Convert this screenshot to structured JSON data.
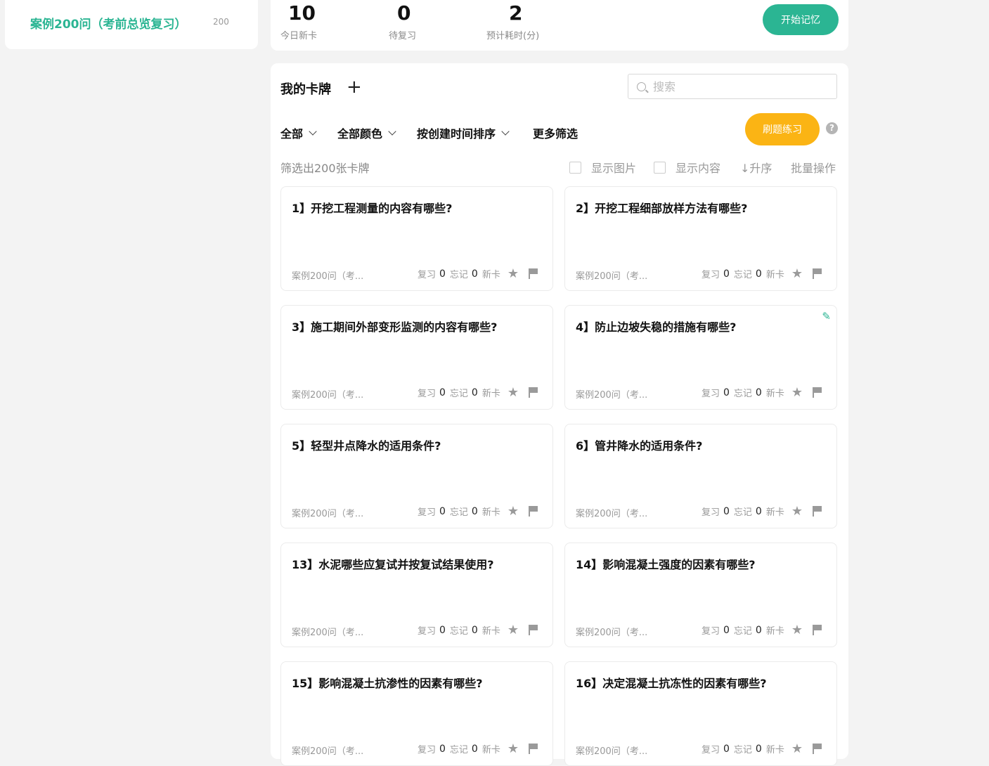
{
  "sidebar": {
    "deck_name": "案例200问（考前总览复习）",
    "deck_count": "200"
  },
  "stats": [
    {
      "value": "10",
      "label": "今日新卡"
    },
    {
      "value": "0",
      "label": "待复习"
    },
    {
      "value": "2",
      "label": "预计耗时(分)"
    }
  ],
  "start_button": "开始记忆",
  "main": {
    "title": "我的卡牌",
    "add_symbol": "+",
    "search_placeholder": "搜索",
    "filters": {
      "all": "全部",
      "color": "全部颜色",
      "sort": "按创建时间排序",
      "more": "更多筛选"
    },
    "practice_button": "刷题练习",
    "help_symbol": "?",
    "count_text": "筛选出200张卡牌",
    "show_image": "显示图片",
    "show_content": "显示内容",
    "order": "↓升序",
    "batch": "批量操作"
  },
  "card_meta": {
    "deck": "案例200问（考...",
    "review_label": "复习",
    "forget_label": "忘记",
    "new_label": "新卡"
  },
  "cards": [
    {
      "question": "1】开挖工程测量的内容有哪些?",
      "review": "0",
      "forget": "0"
    },
    {
      "question": "2】开挖工程细部放样方法有哪些?",
      "review": "0",
      "forget": "0"
    },
    {
      "question": "3】施工期间外部变形监测的内容有哪些?",
      "review": "0",
      "forget": "0"
    },
    {
      "question": "4】防止边坡失稳的措施有哪些?",
      "review": "0",
      "forget": "0"
    },
    {
      "question": "5】轻型井点降水的适用条件?",
      "review": "0",
      "forget": "0"
    },
    {
      "question": "6】管井降水的适用条件?",
      "review": "0",
      "forget": "0"
    },
    {
      "question": "13】水泥哪些应复试并按复试结果使用?",
      "review": "0",
      "forget": "0"
    },
    {
      "question": "14】影响混凝土强度的因素有哪些?",
      "review": "0",
      "forget": "0"
    },
    {
      "question": "15】影响混凝土抗渗性的因素有哪些?",
      "review": "0",
      "forget": "0"
    },
    {
      "question": "16】决定混凝土抗冻性的因素有哪些?",
      "review": "0",
      "forget": "0"
    }
  ]
}
